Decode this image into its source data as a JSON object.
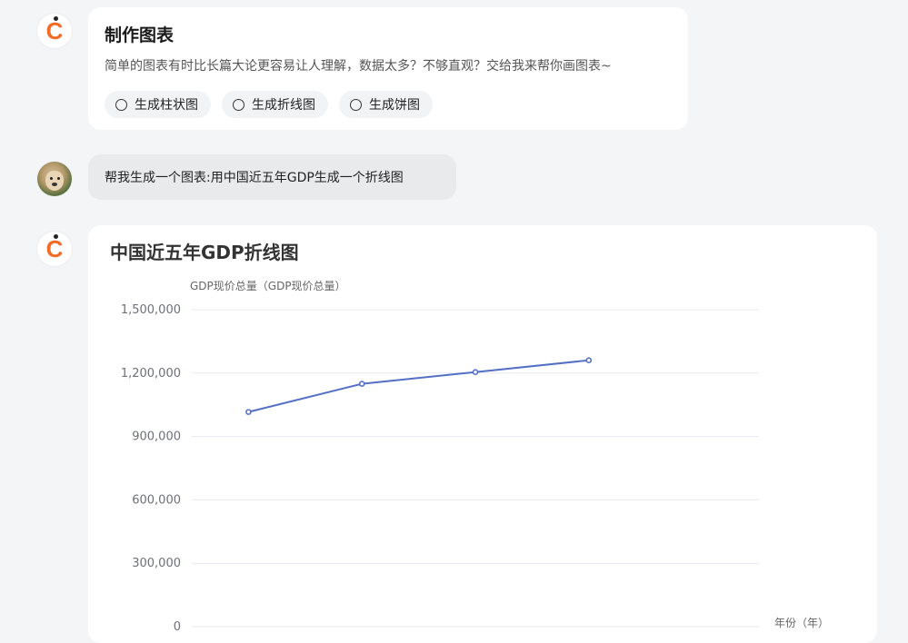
{
  "intro": {
    "title": "制作图表",
    "desc": "简单的图表有时比长篇大论更容易让人理解，数据太多？不够直观？交给我来帮你画图表~",
    "chips": [
      "生成柱状图",
      "生成折线图",
      "生成饼图"
    ]
  },
  "user_message": {
    "text": "帮我生成一个图表:用中国近五年GDP生成一个折线图"
  },
  "chart_card": {
    "title": "中国近五年GDP折线图"
  },
  "chart_data": {
    "type": "line",
    "title": "中国近五年GDP折线图",
    "ylabel": "GDP现价总量（GDP现价总量）",
    "xlabel": "年份（年）",
    "ylim": [
      0,
      1500000
    ],
    "yticks": [
      0,
      300000,
      600000,
      900000,
      1200000,
      1500000
    ],
    "ytick_labels": [
      "0",
      "300,000",
      "600,000",
      "900,000",
      "1,200,000",
      "1,500,000"
    ],
    "series": [
      {
        "values": [
          1015986,
          1149237,
          1204724,
          1260582
        ],
        "color": "#5470c6"
      }
    ],
    "grid": true
  }
}
